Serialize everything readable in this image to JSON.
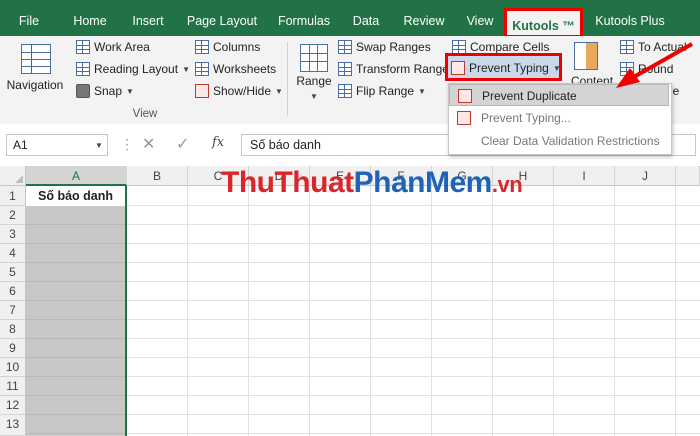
{
  "tabs": [
    {
      "label": "File"
    },
    {
      "label": "Home"
    },
    {
      "label": "Insert"
    },
    {
      "label": "Page Layout"
    },
    {
      "label": "Formulas"
    },
    {
      "label": "Data"
    },
    {
      "label": "Review"
    },
    {
      "label": "View"
    },
    {
      "label": "Kutools ™",
      "active": true
    },
    {
      "label": "Kutools Plus"
    }
  ],
  "ribbon": {
    "navigation": "Navigation",
    "work_area": "Work Area",
    "reading_layout": "Reading Layout",
    "snap": "Snap",
    "columns": "Columns",
    "worksheets": "Worksheets",
    "show_hide": "Show/Hide",
    "view_group": "View",
    "range": "Range",
    "swap_ranges": "Swap Ranges",
    "transform_range": "Transform Range",
    "flip_range": "Flip Range",
    "compare_cells": "Compare Cells",
    "prevent_typing": "Prevent Typing",
    "content": "Content",
    "to_actual": "To Actual",
    "round": "Round",
    "one": "ne"
  },
  "dropdown": {
    "items": [
      {
        "label": "Prevent Duplicate",
        "highlighted": true
      },
      {
        "label": "Prevent Typing..."
      },
      {
        "label": "Clear Data Validation Restrictions"
      }
    ]
  },
  "formula_bar": {
    "name_box": "A1",
    "fx": "fx",
    "value": "Số báo danh"
  },
  "sheet": {
    "columns": [
      "A",
      "B",
      "C",
      "D",
      "E",
      "F",
      "G",
      "H",
      "I",
      "J"
    ],
    "rows": [
      "1",
      "2",
      "3",
      "4",
      "5",
      "6",
      "7",
      "8",
      "9",
      "10",
      "11",
      "12",
      "13"
    ],
    "cells": {
      "A1": "Số báo danh"
    }
  },
  "watermark": {
    "part1": "ThuThuat",
    "part2": "PhanMem",
    "part3": ".vn"
  },
  "colors": {
    "excel_green": "#217346",
    "highlight_red": "#e00000",
    "selection_gray": "#c8c8c8"
  }
}
